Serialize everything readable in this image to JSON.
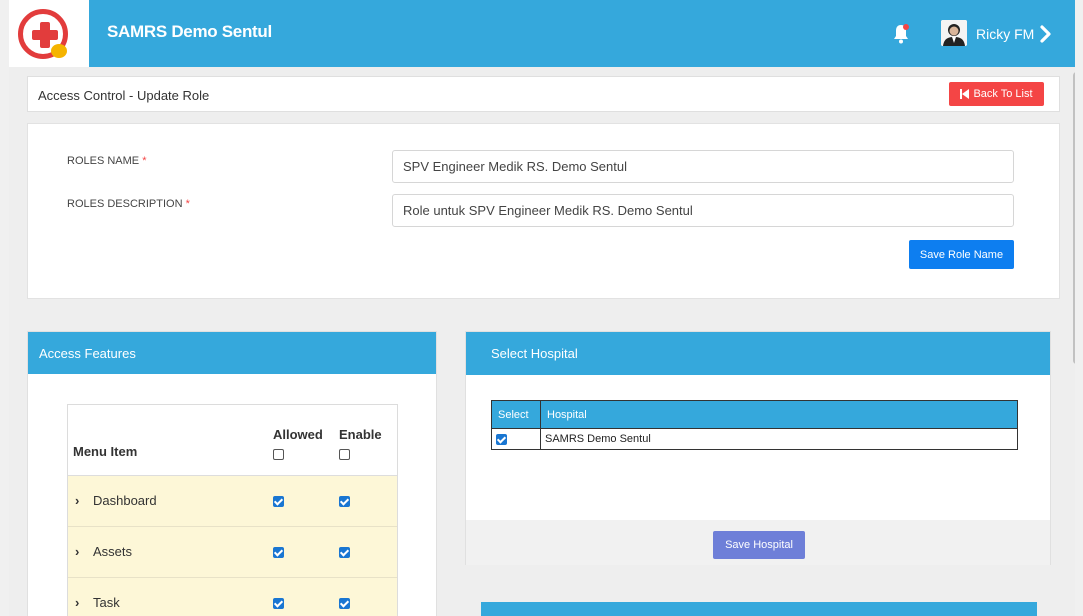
{
  "header": {
    "app_title": "SAMRS Demo Sentul",
    "user_name": "Ricky FM",
    "colors": {
      "bar": "#35a8dc",
      "accent_red": "#e23c3c"
    },
    "icons": [
      "logo-icon",
      "bell-icon",
      "avatar",
      "chevron-right-icon"
    ]
  },
  "breadcrumb": {
    "title": "Access Control - Update Role",
    "back_label": "Back To List"
  },
  "role_form": {
    "name_label": "ROLES NAME",
    "name_value": "SPV Engineer Medik RS. Demo Sentul",
    "desc_label": "ROLES DESCRIPTION",
    "desc_value": "Role untuk SPV Engineer Medik RS. Demo Sentul",
    "required_mark": "*",
    "save_label": "Save Role Name"
  },
  "access_features": {
    "title": "Access Features",
    "columns": {
      "menu": "Menu Item",
      "allowed": "Allowed",
      "enable": "Enable"
    },
    "rows": [
      {
        "label": "Dashboard",
        "allowed": true,
        "enable": true
      },
      {
        "label": "Assets",
        "allowed": true,
        "enable": true
      },
      {
        "label": "Task",
        "allowed": true,
        "enable": true
      }
    ]
  },
  "select_hospital": {
    "title": "Select Hospital",
    "columns": {
      "select": "Select",
      "hospital": "Hospital"
    },
    "rows": [
      {
        "selected": true,
        "name": "SAMRS Demo Sentul"
      }
    ],
    "save_label": "Save Hospital"
  }
}
